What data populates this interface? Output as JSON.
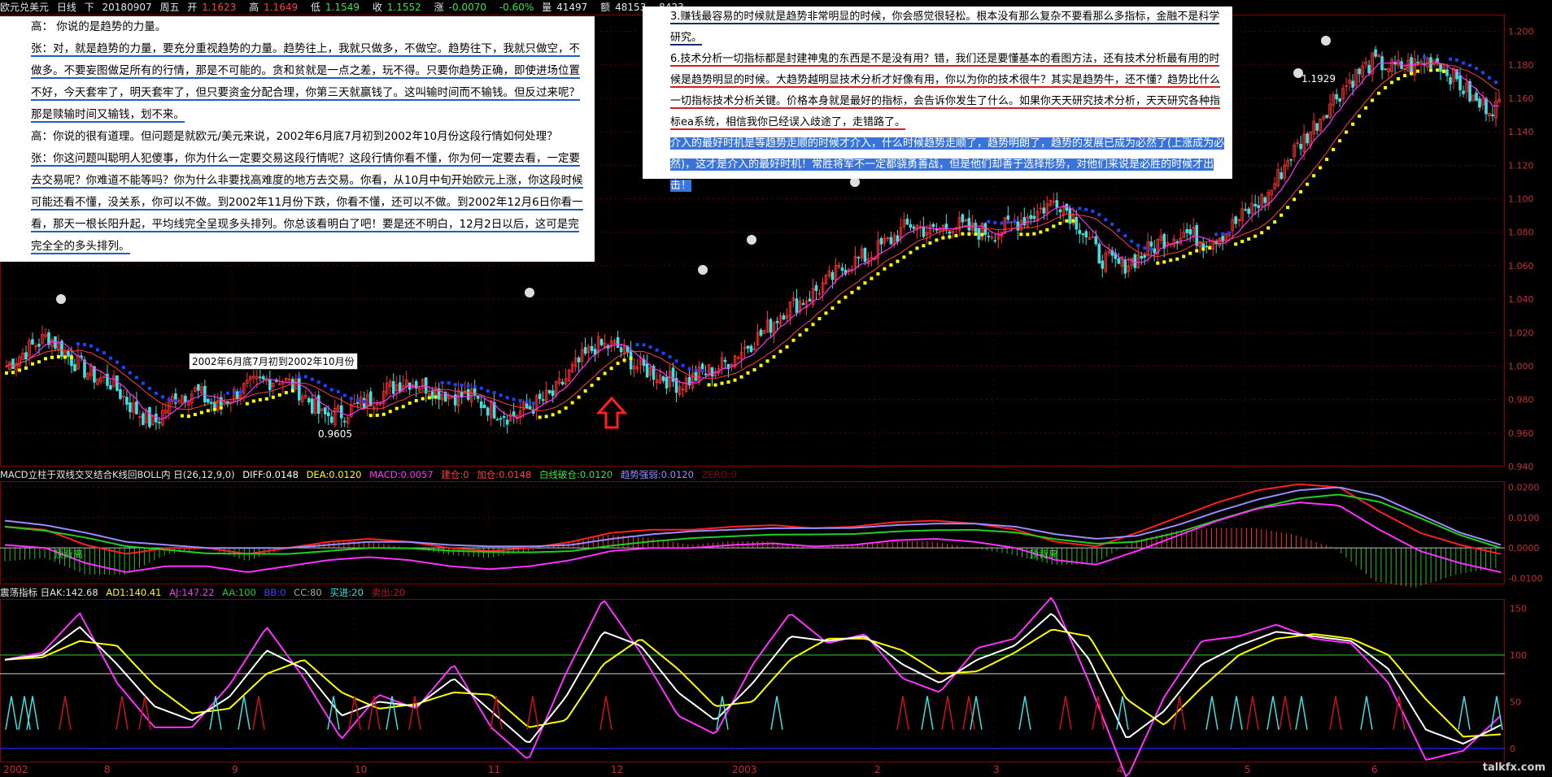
{
  "header": {
    "instrument": "欧元兑美元",
    "period": "日线",
    "direction": "下",
    "date": "20180907",
    "weekday": "周五",
    "open_label": "开",
    "open": "1.1623",
    "high_label": "高",
    "high": "1.1649",
    "low_label": "低",
    "low": "1.1549",
    "close_label": "收",
    "close": "1.1552",
    "change_label": "涨",
    "change": "-0.0070",
    "change_pct": "-0.60%",
    "volume_label": "量",
    "volume": "41497",
    "amount_label": "额",
    "amount": "48153",
    "last": "8423"
  },
  "macd_header": {
    "title": "MACD立柱于双线交叉结合K线回BOLL内 日(26,12,9,0)",
    "diff": "DIFF:0.0148",
    "dea": "DEA:0.0120",
    "macd": "MACD:0.0057",
    "jiancang": "建仓:0",
    "jiacang": "加仓:0.0148",
    "baixian": "白线破仓:0.0120",
    "qushi": "趋势强弱:0.0120",
    "zero": "ZERO:0"
  },
  "osc_header": {
    "title": "震荡指标 日AK:142.68",
    "ad1": "AD1:140.41",
    "aj": "AJ:147.22",
    "aa": "AA:100",
    "bb": "BB:0",
    "cc": "CC:80",
    "buy": "买进:20",
    "sell": "卖出:20"
  },
  "text_left": {
    "p1": "高： 你说的是趋势的力量。",
    "p2": "张：对，就是趋势的力量，要充分重视趋势的力量。趋势往上，我就只做多，不做空。趋势往下，我就只做空，不做多。不要妄图做足所有的行情，那是不可能的。贪和贫就是一点之差，玩不得。只要你趋势正确，即使进场位置不好，今天套牢了，明天套牢了，但只要资金分配合理，你第三天就赢钱了。这叫输时间而不输钱。但反过来呢？那是赎输时间又输钱，划不来。",
    "p3": "高：你说的很有道理。但问题是就欧元/美元来说，2002年6月底7月初到2002年10月份这段行情如何处理？",
    "p4": "张：你这问题叫聪明人犯傻事，你为什么一定要交易这段行情呢？这段行情你看不懂，你为何一定要去看，一定要去交易呢？你难道不能等吗？你为什么非要找高难度的地方去交易。你看，从10月中旬开始欧元上涨，你这段时候可能还看不懂，没关系，你可以不做。到2002年11月份下跌，你看不懂，还可以不做。到2002年12月6日你看一看，那天一根长阳升起，平均线完全呈现多头排列。你总该看明白了吧！要是还不明白，12月2日以后，这可是完完全全的多头排列。"
  },
  "text_right": {
    "p1": "3.赚钱最容易的时候就是趋势非常明显的时候，你会感觉很轻松。根本没有那么复杂不要看那么多指标，金融不是科学研究。",
    "p2": "6.技术分析一切指标都是封建神鬼的东西是不是没有用？错，我们还是要懂基本的看图方法，还有技术分析最有用的时候是趋势明显的时候。大趋势越明显技术分析才好像有用，你以为你的技术很牛？其实是趋势牛，还不懂？趋势比什么一切指标技术分析关键。价格本身就是最好的指标，会告诉你发生了什么。如果你天天研究技术分析，天天研究各种指标ea系统，相信我你已经误入歧途了，走错路了。",
    "p3": "介入的最好时机是等趋势走顺的时候才介入，什么时候趋势走顺了，趋势明朗了，趋势的发展已成为必然了(上涨成为必然)，这才是介入的最好时机！常胜将军不一定都骁勇善战，但是他们却善于选择形势，对他们来说是必胜的时候才出击！"
  },
  "annotations": {
    "range_label": "2002年6月底7月初到2002年10月份",
    "low_label": "0.9605",
    "high_label": "1.1929",
    "macd_tag1": "顶背离",
    "macd_tag2": "顶背离"
  },
  "watermark": "talkfx.com",
  "x_axis": [
    "2002",
    "8",
    "9",
    "10",
    "11",
    "12",
    "2003",
    "2",
    "3",
    "4",
    "5",
    "6"
  ],
  "colors": {
    "up": "#ff3030",
    "down": "#40e0e0",
    "support": "#ffff00",
    "resistance": "#2040ff",
    "dif": "#ff2020",
    "dea": "#9a8cff",
    "third": "#20d020",
    "macd_pos": "#ff3030",
    "macd_neg": "#20c020",
    "ak": "#ffffff",
    "ad1": "#ffff00",
    "aj": "#ff30ff",
    "aa": "#20c020",
    "bb": "#2020ff",
    "cc": "#aaaaaa",
    "buy": "#40e0e0",
    "sell": "#cc1020"
  },
  "chart_data": [
    {
      "type": "candlestick",
      "title": "欧元兑美元 日线",
      "x_axis_labels": [
        "2002",
        "8",
        "9",
        "10",
        "11",
        "12",
        "2003",
        "2",
        "3",
        "4",
        "5",
        "6"
      ],
      "ylim": [
        0.94,
        1.21
      ],
      "y_ticks": [
        0.94,
        0.96,
        0.98,
        1.0,
        1.02,
        1.04,
        1.06,
        1.08,
        1.1,
        1.12,
        1.14,
        1.16,
        1.18,
        1.2
      ],
      "price_path": [
        1.0,
        1.01,
        1.018,
        1.005,
        0.995,
        0.99,
        0.975,
        0.965,
        0.982,
        0.985,
        0.975,
        0.985,
        0.99,
        0.993,
        0.985,
        0.97,
        0.972,
        0.978,
        0.985,
        0.992,
        0.988,
        0.983,
        0.982,
        0.975,
        0.97,
        0.976,
        0.983,
        0.999,
        1.012,
        1.012,
        1.0,
        0.995,
        0.989,
        0.995,
        1.0,
        1.01,
        1.02,
        1.034,
        1.04,
        1.05,
        1.061,
        1.066,
        1.075,
        1.085,
        1.08,
        1.085,
        1.081,
        1.08,
        1.086,
        1.092,
        1.1,
        1.085,
        1.065,
        1.06,
        1.066,
        1.076,
        1.08,
        1.075,
        1.08,
        1.092,
        1.102,
        1.125,
        1.14,
        1.158,
        1.172,
        1.182,
        1.178,
        1.18,
        1.184,
        1.17,
        1.156,
        1.155
      ],
      "annotated_low": 0.9605,
      "annotated_high": 1.1929
    },
    {
      "type": "line",
      "title": "MACD立柱于双线交叉结合K线回BOLL内 日(26,12,9,0)",
      "ylim": [
        -0.012,
        0.022
      ],
      "y_ticks": [
        -0.01,
        0.0,
        0.01,
        0.02
      ],
      "series": [
        {
          "name": "DIFF",
          "values": [
            0.007,
            0.006,
            0.001,
            -0.002,
            0.0,
            0.0,
            -0.002,
            0.0,
            0.002,
            0.003,
            0.002,
            0.0,
            -0.001,
            0.0,
            0.002,
            0.005,
            0.006,
            0.006,
            0.007,
            0.0075,
            0.0065,
            0.007,
            0.0085,
            0.009,
            0.008,
            0.006,
            0.002,
            0.0005,
            0.005,
            0.01,
            0.015,
            0.019,
            0.021,
            0.02,
            0.012,
            0.005,
            0.001,
            -0.002
          ]
        },
        {
          "name": "DEA",
          "values": [
            0.009,
            0.0075,
            0.005,
            0.002,
            0.001,
            0.0,
            0.0,
            0.0,
            0.001,
            0.002,
            0.002,
            0.001,
            0.0005,
            0.0005,
            0.001,
            0.003,
            0.0045,
            0.0055,
            0.006,
            0.0065,
            0.0065,
            0.0066,
            0.0075,
            0.008,
            0.008,
            0.007,
            0.0045,
            0.003,
            0.004,
            0.0075,
            0.012,
            0.016,
            0.019,
            0.02,
            0.017,
            0.011,
            0.005,
            0.001
          ]
        }
      ]
    },
    {
      "type": "line",
      "title": "震荡指标 日",
      "ylim": [
        -15,
        160
      ],
      "y_ticks": [
        0,
        50,
        100,
        150
      ],
      "series": [
        {
          "name": "AK",
          "values": [
            95,
            100,
            130,
            90,
            45,
            30,
            55,
            105,
            85,
            35,
            50,
            45,
            75,
            40,
            5,
            55,
            125,
            110,
            60,
            30,
            70,
            120,
            115,
            120,
            90,
            70,
            95,
            110,
            145,
            95,
            10,
            40,
            90,
            110,
            125,
            120,
            115,
            85,
            20,
            5,
            25
          ]
        },
        {
          "name": "AA",
          "values": [
            100,
            100,
            100,
            100,
            100,
            100,
            100,
            100,
            100,
            100,
            100,
            100,
            100,
            100,
            100,
            100,
            100,
            100,
            100,
            100,
            100,
            100,
            100,
            100,
            100,
            100,
            100,
            100,
            100,
            100,
            100,
            100,
            100,
            100,
            100,
            100,
            100,
            100,
            100,
            100,
            100
          ]
        },
        {
          "name": "CC",
          "values": [
            80,
            80,
            80,
            80,
            80,
            80,
            80,
            80,
            80,
            80,
            80,
            80,
            80,
            80,
            80,
            80,
            80,
            80,
            80,
            80,
            80,
            80,
            80,
            80,
            80,
            80,
            80,
            80,
            80,
            80,
            80,
            80,
            80,
            80,
            80,
            80,
            80,
            80,
            80,
            80,
            80
          ]
        },
        {
          "name": "BB",
          "values": [
            0,
            0,
            0,
            0,
            0,
            0,
            0,
            0,
            0,
            0,
            0,
            0,
            0,
            0,
            0,
            0,
            0,
            0,
            0,
            0,
            0,
            0,
            0,
            0,
            0,
            0,
            0,
            0,
            0,
            0,
            0,
            0,
            0,
            0,
            0,
            0,
            0,
            0,
            0,
            0,
            0
          ]
        }
      ]
    }
  ]
}
